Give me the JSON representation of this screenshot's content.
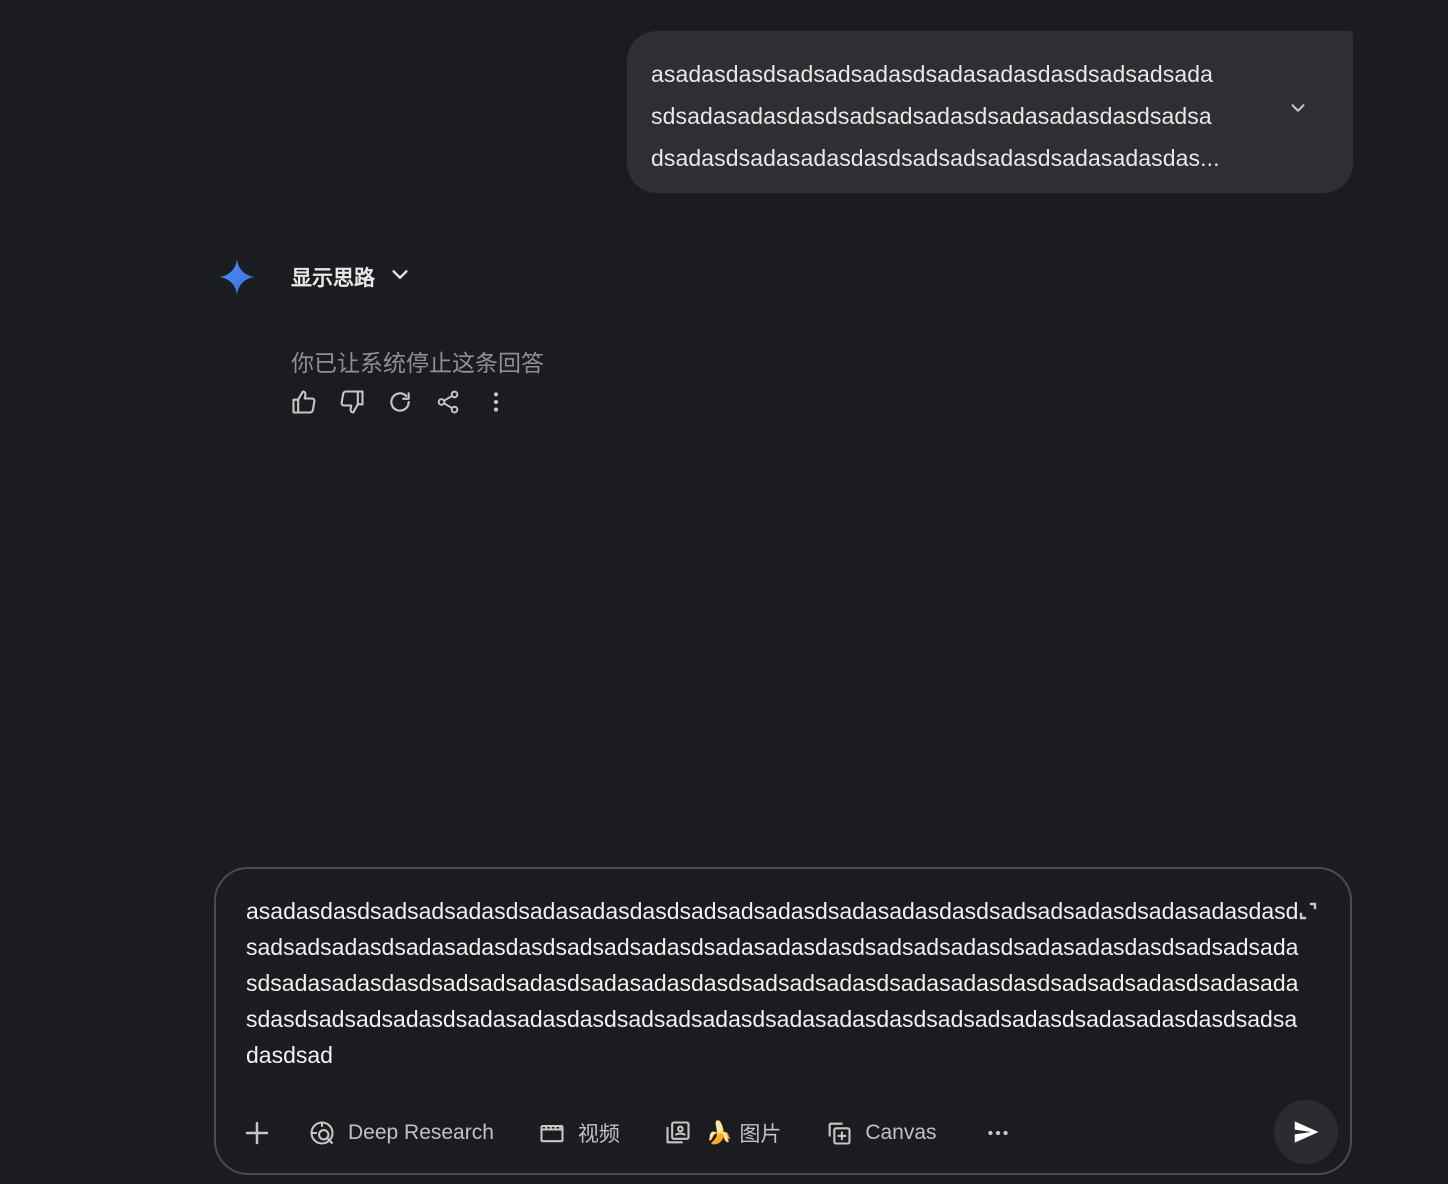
{
  "user_message": {
    "lines": [
      "asadasdasdsadsadsadasdsadasadasdasdsadsadsada",
      "sdsadasadasdasdsadsadsadasdsadasadasdasdsadsa",
      "dsadasdsadasadasdasdsadsadsadasdsadasadasdas..."
    ],
    "expand_icon": "chevron-down-icon"
  },
  "response": {
    "logo_icon": "gemini-sparkle-icon",
    "show_thinking_label": "显示思路",
    "stopped_text": "你已让系统停止这条回答",
    "actions": [
      "thumbs-up-icon",
      "thumbs-down-icon",
      "redo-icon",
      "share-icon",
      "more-vert-icon"
    ]
  },
  "composer": {
    "value": "asadasdasdsadsadsadasdsadasadasdasdsadsadsadasdsadasadasdasdsadsadsadasdsadasadasdasdsadsadsadasdsadasadasdasdsadsadsadasdsadasadasdasdsadsadsadasdsadasadasdasdsadsadsadasdsadasadasdasdsadsadsadasdsadasadasdasdsadsadsadasdsadasadasdasdsadsadsadasdsadasadasdasdsadsadsadasdsadasadasdasdsadsadsadasdsadasadasdasdsadsadsadasdsadasadasdasdsadsadasdsad",
    "tools": {
      "add_icon": "plus-icon",
      "deep_research": "Deep Research",
      "video": "视频",
      "image_emoji": "🍌",
      "image": "图片",
      "canvas": "Canvas",
      "more": "···"
    },
    "send_icon": "send-icon"
  },
  "colors": {
    "background": "#1b1c1f",
    "bubble": "#2e2f33",
    "accent_blue": "#4c8df6",
    "muted_text": "#8e9094"
  }
}
